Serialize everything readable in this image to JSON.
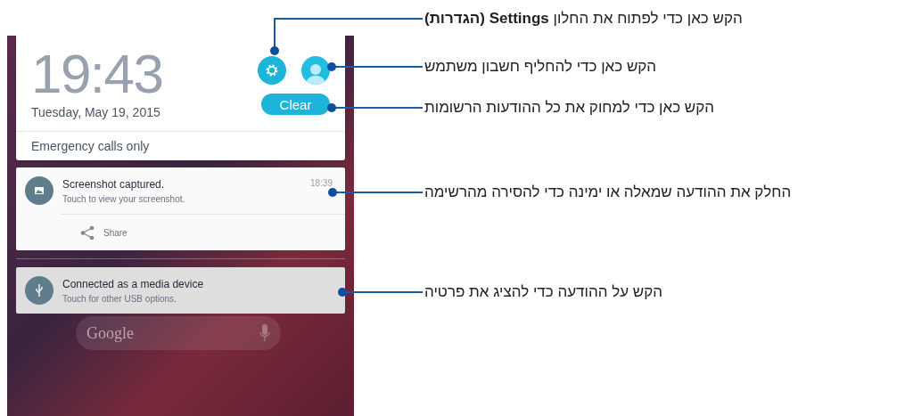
{
  "clock": {
    "time": "19:43",
    "date": "Tuesday, May 19, 2015"
  },
  "clear_button": "Clear",
  "status": "Emergency calls only",
  "notifications": [
    {
      "kind": "image",
      "title": "Screenshot captured.",
      "text": "Touch to view your screenshot.",
      "time": "18:39",
      "action": "Share",
      "selected": false
    },
    {
      "kind": "usb",
      "title": "Connected as a media device",
      "text": "Touch for other USB options.",
      "selected": true
    }
  ],
  "search": {
    "placeholder": "Google"
  },
  "callouts": [
    "הקש כאן כדי לפתוח את החלון **Settings (הגדרות)**",
    "הקש כאן כדי להחליף חשבון משתמש",
    "הקש כאן כדי למחוק את כל ההודעות הרשומות",
    "החלק את ההודעה שמאלה או ימינה כדי להסירה מהרשימה",
    "הקש על ההודעה כדי להציג את פרטיה"
  ]
}
